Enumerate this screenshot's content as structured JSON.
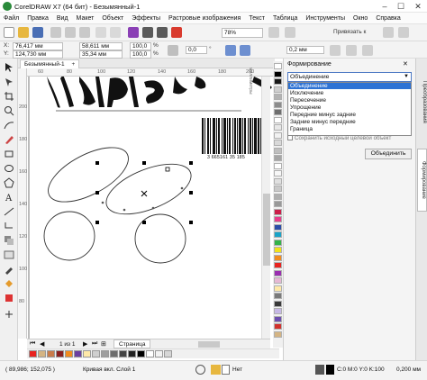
{
  "window": {
    "title": "CorelDRAW X7 (64 бит) - Безымянный-1",
    "minimize": "–",
    "maximize": "☐",
    "close": "✕"
  },
  "menu": [
    "Файл",
    "Правка",
    "Вид",
    "Макет",
    "Объект",
    "Эффекты",
    "Растровые изображения",
    "Текст",
    "Таблица",
    "Инструменты",
    "Окно",
    "Справка"
  ],
  "std_toolbar": {
    "zoom_value": "78%",
    "snap_label": "Привязать к"
  },
  "prop_bar": {
    "x_label": "X:",
    "x_value": "76,417 мм",
    "y_label": "Y:",
    "y_value": "124,730 мм",
    "w_value": "58,611 мм",
    "h_value": "35,34 мм",
    "sx_value": "100,0",
    "sy_value": "100,0",
    "pct": "%",
    "angle_value": "0,0",
    "degree": "°",
    "outline_value": "0,2 мм"
  },
  "document": {
    "tab_label": "Безымянный-1",
    "ruler_top": [
      "60",
      "80",
      "100",
      "120",
      "140",
      "160",
      "180",
      "200"
    ],
    "ruler_unit": "миллиметры",
    "ruler_left": [
      "200",
      "180",
      "160",
      "140",
      "120",
      "100",
      "80"
    ],
    "barcode_number": "3 665161 35 185"
  },
  "page_nav": {
    "page_info": "1 из 1",
    "page_tab": "Страница"
  },
  "palette_colors": [
    "#ffffff",
    "#000000",
    "#1a1a1a",
    "#cfcfcf",
    "#b3b3b3",
    "#8c8c8c",
    "#6e6e6e",
    "#ffffff",
    "#e8e8e8",
    "#f2f2f2",
    "#d9d9d9",
    "#bfbfbf",
    "#a6a6a6",
    "#ffffff",
    "#f7f7f7",
    "#e0e0e0",
    "#c9c9c9",
    "#b0b0b0",
    "#999999",
    "#cc1f4a",
    "#e83e8c",
    "#2b4ea8",
    "#1aa3c7",
    "#34b34a",
    "#f1e21b",
    "#f28c1e",
    "#e8231f",
    "#9a2fb0",
    "#e6b8d4",
    "#ffe9a8",
    "#7a7a7a",
    "#3a3a3a",
    "#c7b9e6",
    "#6d4fb0",
    "#d2322d",
    "#d4b483"
  ],
  "bottom_palette": [
    "#e8231f",
    "#d4b483",
    "#c97b4a",
    "#8a1f1f",
    "#f28c1e",
    "#6b3fa0",
    "#ffe9a8",
    "#cfcfcf",
    "#9e9e9e",
    "#6e6e6e",
    "#444444",
    "#222222",
    "#000000",
    "#ffffff",
    "#f2f2f2",
    "#d6d6d6"
  ],
  "docker": {
    "title": "Формирование",
    "combo_value": "Объединение",
    "options": [
      "Объединение",
      "Исключение",
      "Пересечение",
      "Упрощение",
      "Передние минус задние",
      "Задние минус передние",
      "Граница"
    ],
    "selected_index": 0,
    "checkbox_label": "Сохранить исходный целевой объект",
    "merge_button": "Объединить"
  },
  "side_tabs": [
    "Преобразования",
    "Формирование"
  ],
  "status": {
    "coords": "( 89,986; 152,075 )",
    "object_info": "Кривая вкл. Слой 1",
    "fill_label": "Нет",
    "color_info": "C:0 M:0 Y:0 K:100",
    "outline_info": "0,200 мм"
  }
}
